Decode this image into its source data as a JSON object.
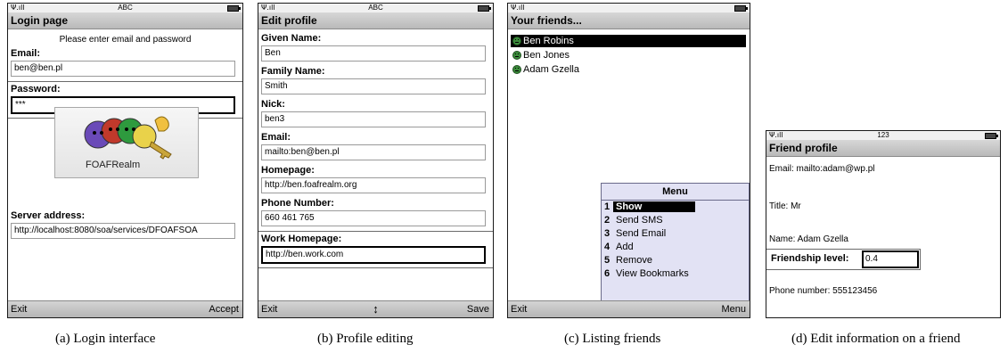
{
  "screens": {
    "login": {
      "status_mode": "ABC",
      "title": "Login page",
      "instruction": "Please enter email and password",
      "email_label": "Email:",
      "email_value": "ben@ben.pl",
      "password_label": "Password:",
      "password_value": "***",
      "logo_text": "FOAFRealm",
      "server_label": "Server address:",
      "server_value": "http://localhost:8080/soa/services/DFOAFSOA",
      "softkey_left": "Exit",
      "softkey_right": "Accept"
    },
    "profile": {
      "status_mode": "ABC",
      "title": "Edit profile",
      "fields": [
        {
          "label": "Given Name:",
          "value": "Ben"
        },
        {
          "label": "Family Name:",
          "value": "Smith"
        },
        {
          "label": "Nick:",
          "value": "ben3"
        },
        {
          "label": "Email:",
          "value": "mailto:ben@ben.pl"
        },
        {
          "label": "Homepage:",
          "value": "http://ben.foafrealm.org"
        },
        {
          "label": "Phone Number:",
          "value": "660 461 765"
        },
        {
          "label": "Work Homepage:",
          "value": "http://ben.work.com"
        }
      ],
      "softkey_left": "Exit",
      "softkey_mid": "↕",
      "softkey_right": "Save"
    },
    "friends": {
      "title": "Your friends...",
      "friends": [
        "Ben Robins",
        "Ben Jones",
        "Adam Gzella"
      ],
      "menu": {
        "title": "Menu",
        "items": [
          {
            "num": "1",
            "label": "Show"
          },
          {
            "num": "2",
            "label": "Send SMS"
          },
          {
            "num": "3",
            "label": "Send Email"
          },
          {
            "num": "4",
            "label": "Add"
          },
          {
            "num": "5",
            "label": "Remove"
          },
          {
            "num": "6",
            "label": "View Bookmarks"
          }
        ]
      },
      "softkey_left": "Exit",
      "softkey_right": "Menu"
    },
    "friend_profile": {
      "status_mode": "123",
      "title": "Friend profile",
      "email": "Email: mailto:adam@wp.pl",
      "title_line": "Title: Mr",
      "name_line": "Name: Adam Gzella",
      "friendship_label": "Friendship level:",
      "friendship_value": "0.4",
      "phone_line": "Phone number: 555123456"
    }
  },
  "captions": [
    "(a)  Login interface",
    "(b)  Profile editing",
    "(c)  Listing friends",
    "(d)  Edit information on a friend"
  ],
  "icons": {
    "signal": "signal-strength-icon",
    "battery": "battery-icon",
    "friend_status": "smiley-icon"
  },
  "colors": {
    "titlebar": "#c8c8c8",
    "selection": "#000000",
    "menu_background": "#e2e2f4",
    "friend_icon": "#3a8a3a"
  }
}
